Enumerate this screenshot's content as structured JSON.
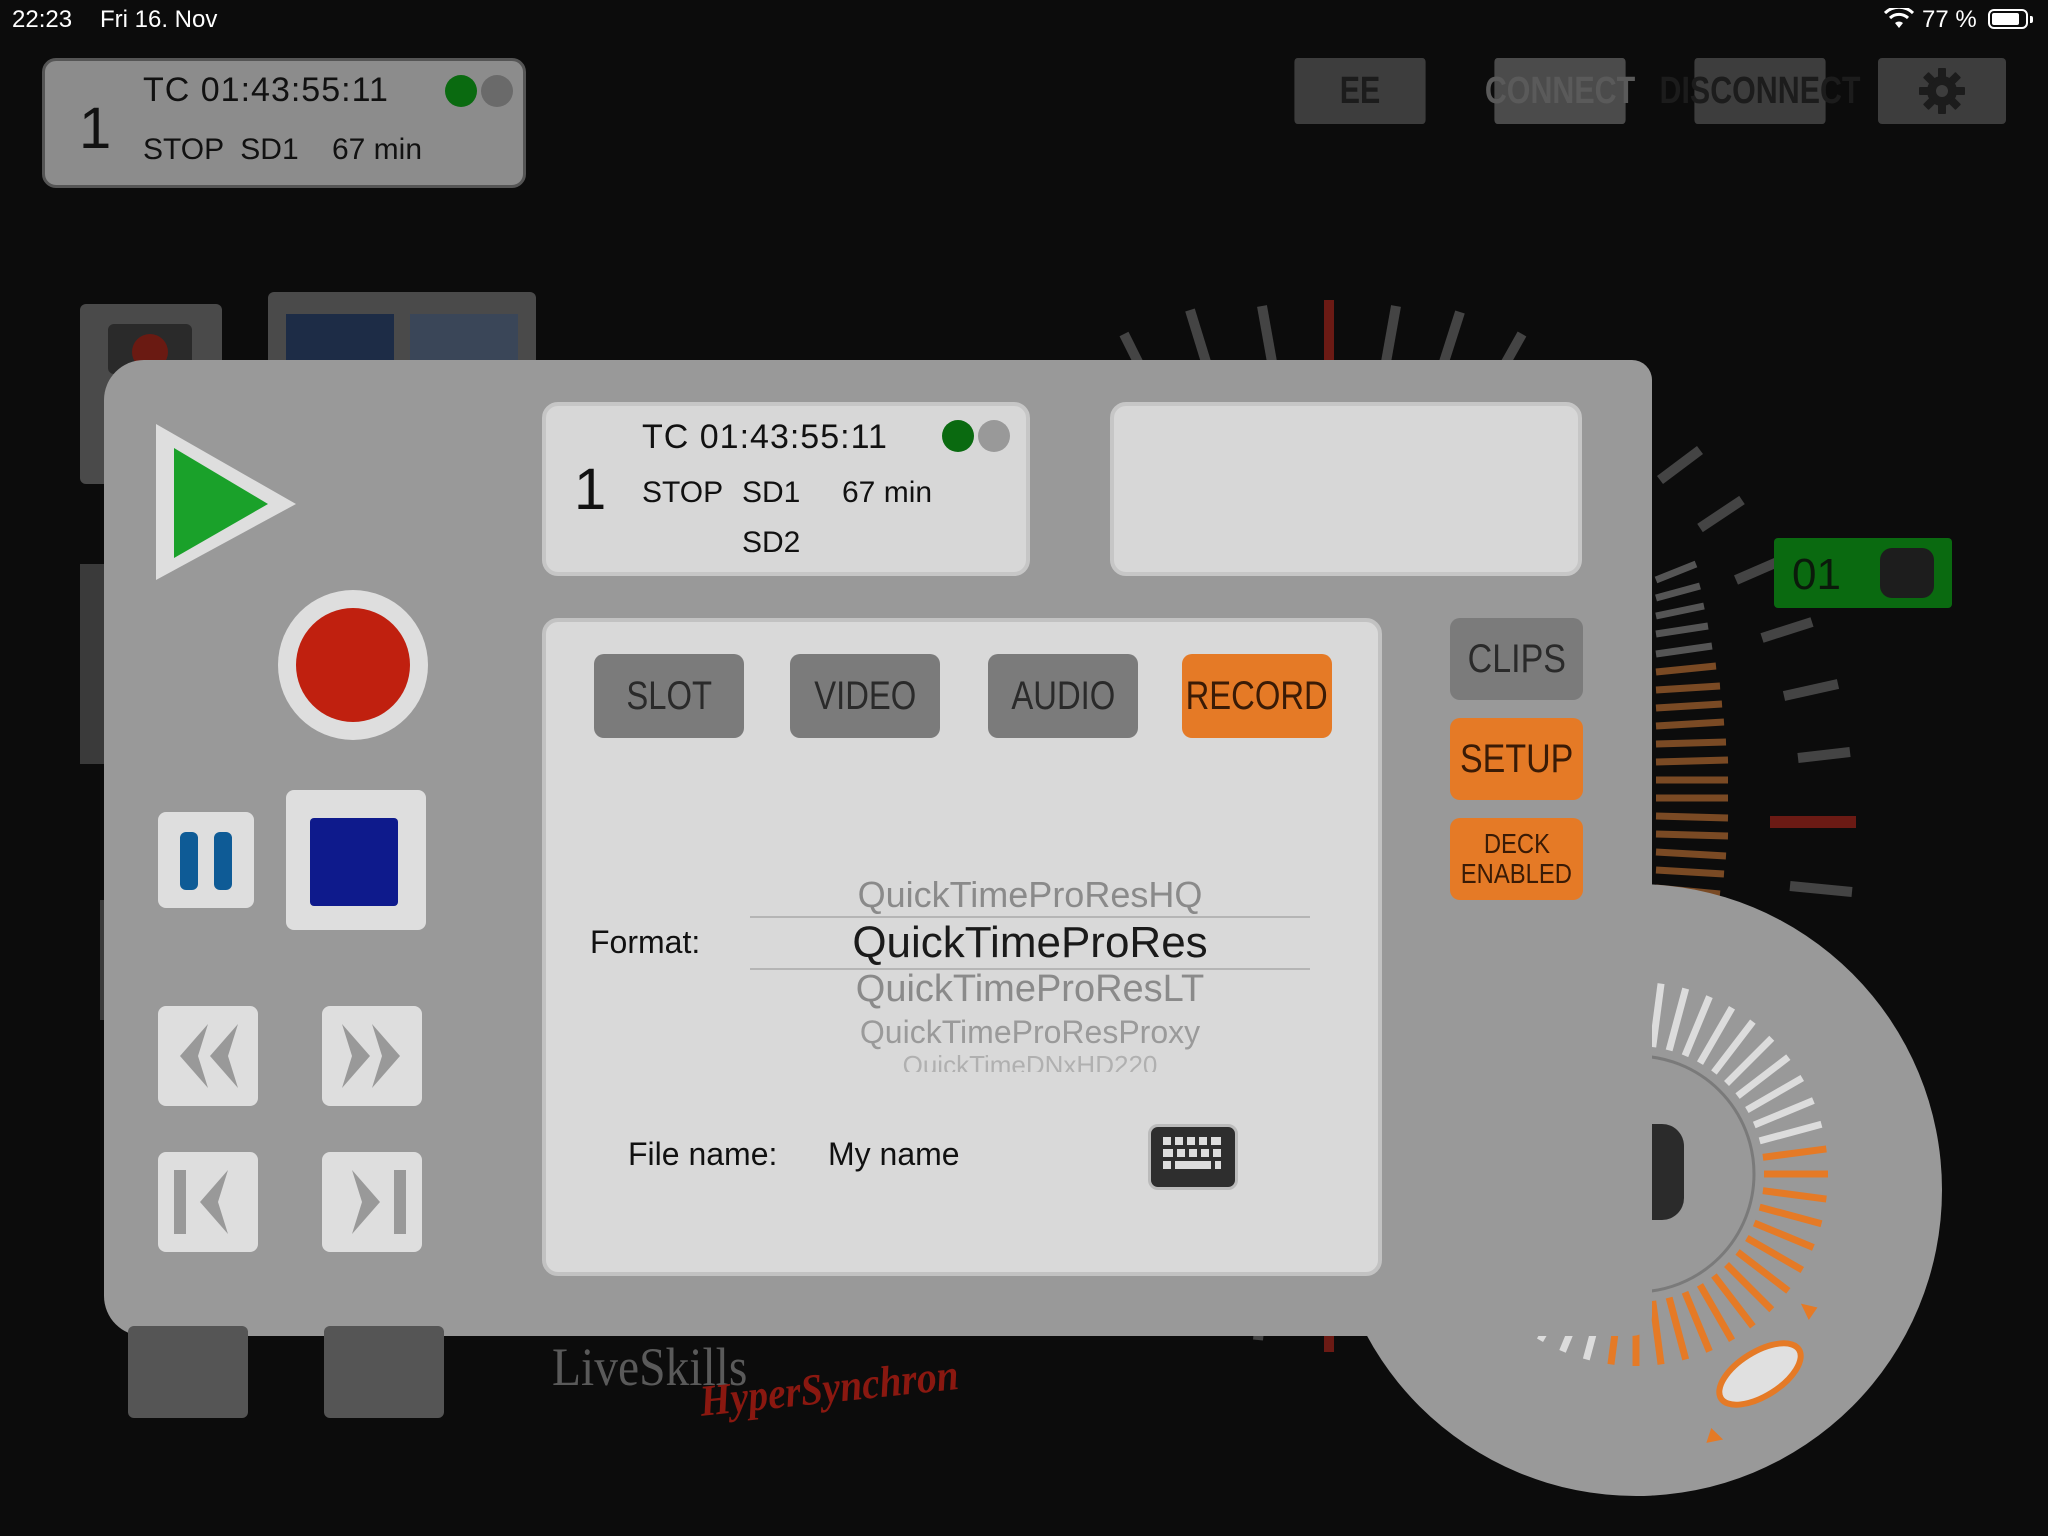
{
  "status_bar": {
    "time": "22:23",
    "date": "Fri 16. Nov",
    "battery": "77 %"
  },
  "deck_mini": {
    "number": "1",
    "timecode": "TC 01:43:55:11",
    "status": "STOP  SD1    67 min"
  },
  "top_buttons": {
    "ee": "EE",
    "connect": "CONNECT",
    "disconnect": "DISCONNECT"
  },
  "deck_display": {
    "number": "1",
    "timecode": "TC 01:43:55:11",
    "state": "STOP",
    "slot1": "SD1",
    "time_left": "67 min",
    "slot2": "SD2"
  },
  "tabs": {
    "slot": "SLOT",
    "video": "VIDEO",
    "audio": "AUDIO",
    "record": "RECORD"
  },
  "side_buttons": {
    "clips": "CLIPS",
    "setup": "SETUP",
    "deck_enabled_line1": "DECK",
    "deck_enabled_line2": "ENABLED"
  },
  "channel_badge": "01",
  "record_settings": {
    "format_label": "Format:",
    "format_options": [
      "QuickTimeProResHQ",
      "QuickTimeProRes",
      "QuickTimeProResLT",
      "QuickTimeProResProxy",
      "QuickTimeDNxHD220"
    ],
    "selected_format": "QuickTimeProRes",
    "file_name_label": "File name:",
    "file_name_value": "My name"
  },
  "logo": {
    "brand": "LiveSkills",
    "product": "HyperSynchron"
  },
  "colors": {
    "accent": "#e57a26",
    "play": "#1aa12a",
    "record": "#c0200f",
    "stop": "#0e1a8c",
    "pause": "#0e5b96",
    "tally_green": "#0a6a10"
  },
  "icons": [
    "play-icon",
    "record-icon",
    "pause-icon",
    "stop-icon",
    "rewind-icon",
    "fast-forward-icon",
    "previous-clip-icon",
    "next-clip-icon",
    "keyboard-icon",
    "gear-icon",
    "wifi-icon",
    "battery-icon"
  ]
}
